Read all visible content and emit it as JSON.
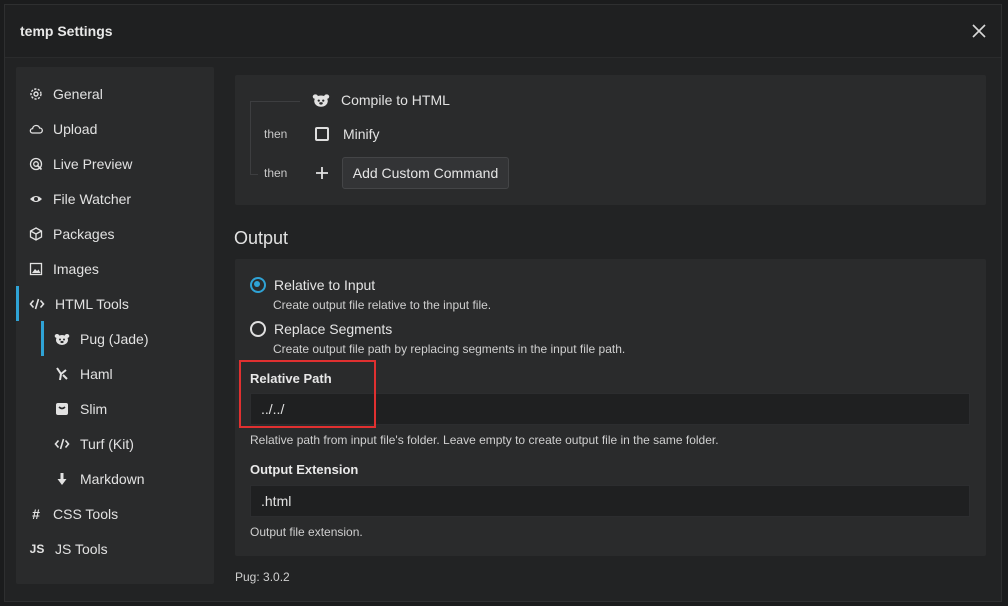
{
  "window": {
    "title": "temp Settings"
  },
  "sidebar": {
    "items": [
      {
        "label": "General",
        "icon": "gear-icon"
      },
      {
        "label": "Upload",
        "icon": "cloud-icon"
      },
      {
        "label": "Live Preview",
        "icon": "live-preview-icon"
      },
      {
        "label": "File Watcher",
        "icon": "eye-icon"
      },
      {
        "label": "Packages",
        "icon": "package-icon"
      },
      {
        "label": "Images",
        "icon": "image-icon"
      },
      {
        "label": "HTML Tools",
        "icon": "code-icon"
      },
      {
        "label": "Pug (Jade)",
        "icon": "pug-icon"
      },
      {
        "label": "Haml",
        "icon": "haml-icon"
      },
      {
        "label": "Slim",
        "icon": "slim-icon"
      },
      {
        "label": "Turf (Kit)",
        "icon": "code-icon"
      },
      {
        "label": "Markdown",
        "icon": "arrow-down-icon"
      },
      {
        "label": "CSS Tools",
        "icon": "hash-icon"
      },
      {
        "label": "JS Tools",
        "icon": "js-icon"
      }
    ]
  },
  "commands": {
    "compile_label": "Compile to HTML",
    "minify_label": "Minify",
    "then_label": "then",
    "add_custom_label": "Add Custom Command"
  },
  "output": {
    "section_title": "Output",
    "relative_to_input": "Relative to Input",
    "relative_to_input_desc": "Create output file relative to the input file.",
    "replace_segments": "Replace Segments",
    "replace_segments_desc": "Create output file path by replacing segments in the input file path.",
    "relative_path_label": "Relative Path",
    "relative_path_value": "../../",
    "relative_path_desc": "Relative path from input file's folder. Leave empty to create output file in the same folder.",
    "extension_label": "Output Extension",
    "extension_value": ".html",
    "extension_desc": "Output file extension."
  },
  "footer": {
    "version": "Pug: 3.0.2"
  },
  "colors": {
    "accent": "#2fa3d6",
    "highlight": "#e03030"
  }
}
